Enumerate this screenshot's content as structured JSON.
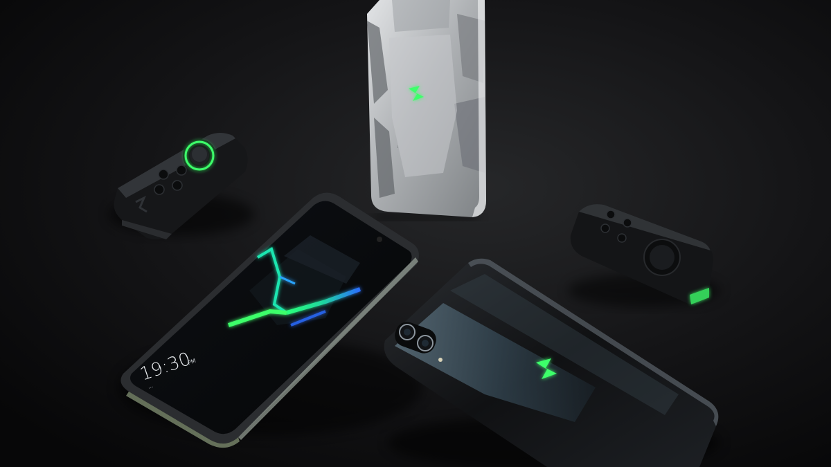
{
  "photo": {
    "colors": {
      "background": "#0b0b0c",
      "accent_green": "#3dff6a",
      "silver": "#b9bcbf",
      "glossy_black": "#141517"
    },
    "lock_screen": {
      "time": "19:30",
      "date_text": "...",
      "ampm": "PM"
    },
    "objects": [
      "silver-phone-back",
      "black-phone-back",
      "phone-front-screen",
      "left-gamepad-controller",
      "right-gamepad-controller"
    ],
    "icons": {
      "logo": "green-s-logo",
      "joystick": "joystick-icon"
    }
  }
}
